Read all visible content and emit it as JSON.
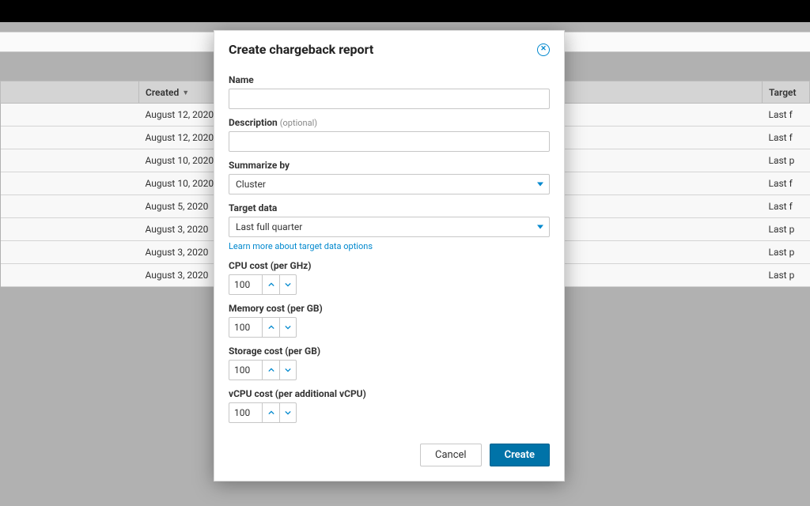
{
  "background": {
    "columns": {
      "created": "Created",
      "target": "Target"
    },
    "rows": [
      {
        "created": "August 12, 2020",
        "target": "Last f"
      },
      {
        "created": "August 12, 2020",
        "target": "Last f"
      },
      {
        "created": "August 10, 2020",
        "target": "Last p"
      },
      {
        "created": "August 10, 2020",
        "target": "Last f"
      },
      {
        "created": "August 5, 2020",
        "target": "Last f"
      },
      {
        "created": "August 3, 2020",
        "target": "Last p"
      },
      {
        "created": "August 3, 2020",
        "target": "Last p"
      },
      {
        "created": "August 3, 2020",
        "target": "Last p"
      }
    ]
  },
  "modal": {
    "title": "Create chargeback report",
    "labels": {
      "name": "Name",
      "description": "Description",
      "description_opt": "(optional)",
      "summarize": "Summarize by",
      "target": "Target data",
      "help": "Learn more about target data options",
      "cpu": "CPU cost (per GHz)",
      "memory": "Memory cost (per GB)",
      "storage": "Storage cost (per GB)",
      "vcpu": "vCPU cost (per additional vCPU)"
    },
    "values": {
      "name": "",
      "description": "",
      "summarize": "Cluster",
      "target": "Last full quarter",
      "cpu": "100",
      "memory": "100",
      "storage": "100",
      "vcpu": "100"
    },
    "buttons": {
      "cancel": "Cancel",
      "create": "Create"
    }
  }
}
